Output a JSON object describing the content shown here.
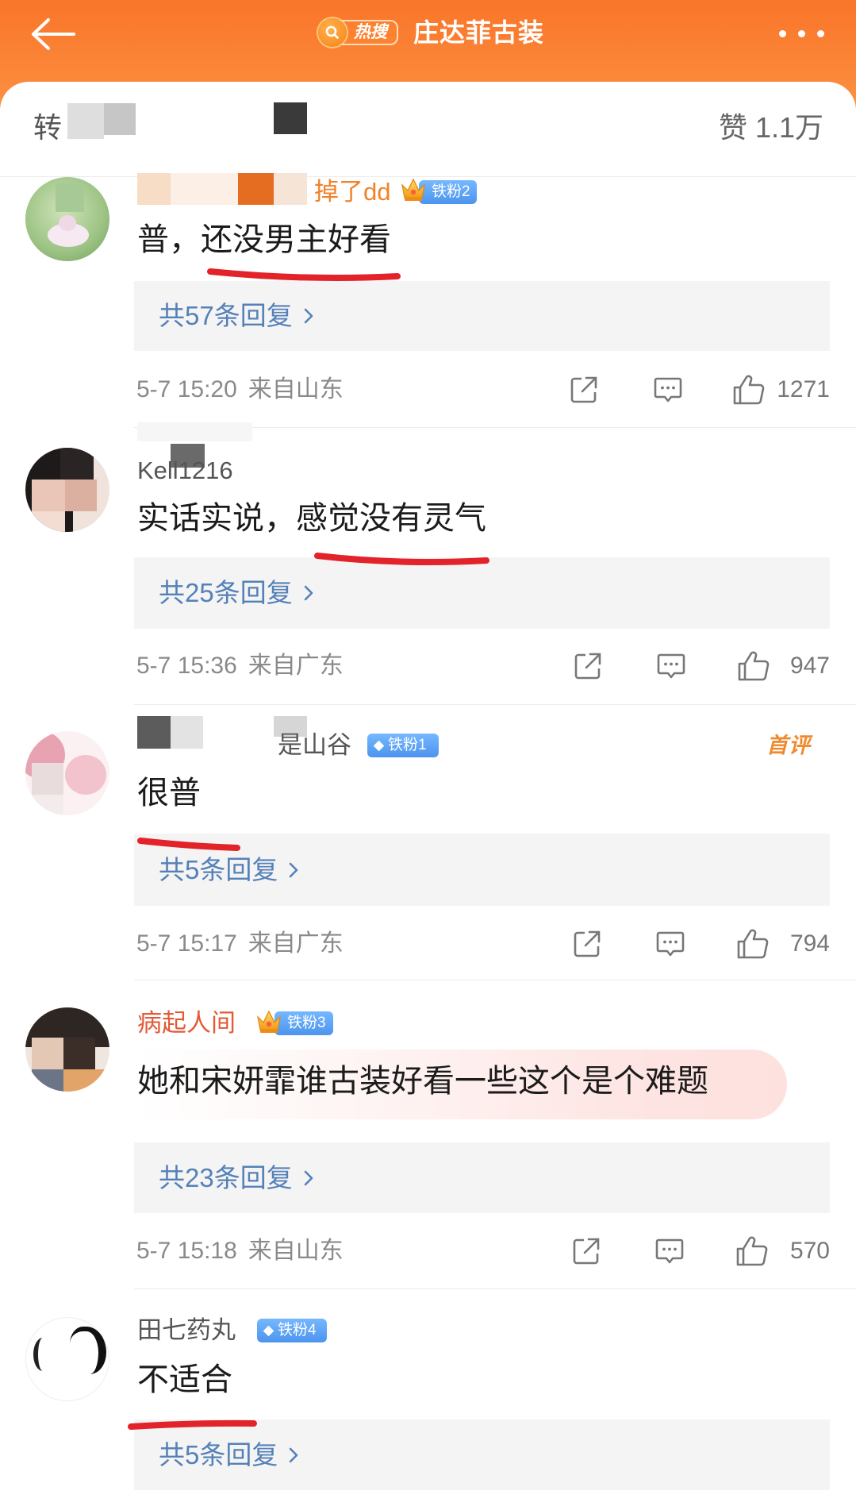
{
  "header": {
    "back_icon": "back-arrow-icon",
    "hot_badge": "热搜",
    "title": "庄达菲古装",
    "more_icon": "more-dots-icon"
  },
  "subheader": {
    "repost_label": "转",
    "likes_label": "赞 1.1万"
  },
  "comments": [
    {
      "username": "掉了dd",
      "badge_icon": "crown-icon",
      "fan_badge": "铁粉2",
      "text": "普，还没男主好看",
      "replies": "共57条回复",
      "time": "5-7 15:20",
      "location": "来自山东",
      "likes": "1271"
    },
    {
      "username": "Kell1216",
      "text": "实话实说，感觉没有灵气",
      "replies": "共25条回复",
      "time": "5-7 15:36",
      "location": "来自广东",
      "likes": "947"
    },
    {
      "username": "是山谷",
      "badge_icon": "diamond-icon",
      "fan_badge": "铁粉1",
      "tag": "首评",
      "text": "很普",
      "replies": "共5条回复",
      "time": "5-7 15:17",
      "location": "来自广东",
      "likes": "794"
    },
    {
      "username": "病起人间",
      "badge_icon": "crown-icon",
      "fan_badge": "铁粉3",
      "text": "她和宋妍霏谁古装好看一些这个是个难题",
      "replies": "共23条回复",
      "time": "5-7 15:18",
      "location": "来自山东",
      "likes": "570"
    },
    {
      "username": "田七药丸",
      "badge_icon": "diamond-icon",
      "fan_badge": "铁粉4",
      "text": "不适合",
      "replies": "共5条回复"
    }
  ],
  "action_icons": [
    "share-icon",
    "comment-icon",
    "like-icon"
  ],
  "colors": {
    "header_orange": "#fb7f2c",
    "link_blue": "#5581b8",
    "annotation_red": "#e2232a",
    "fan_badge_blue": "#5aa2f5",
    "first_comment_orange": "#f08a2e"
  }
}
